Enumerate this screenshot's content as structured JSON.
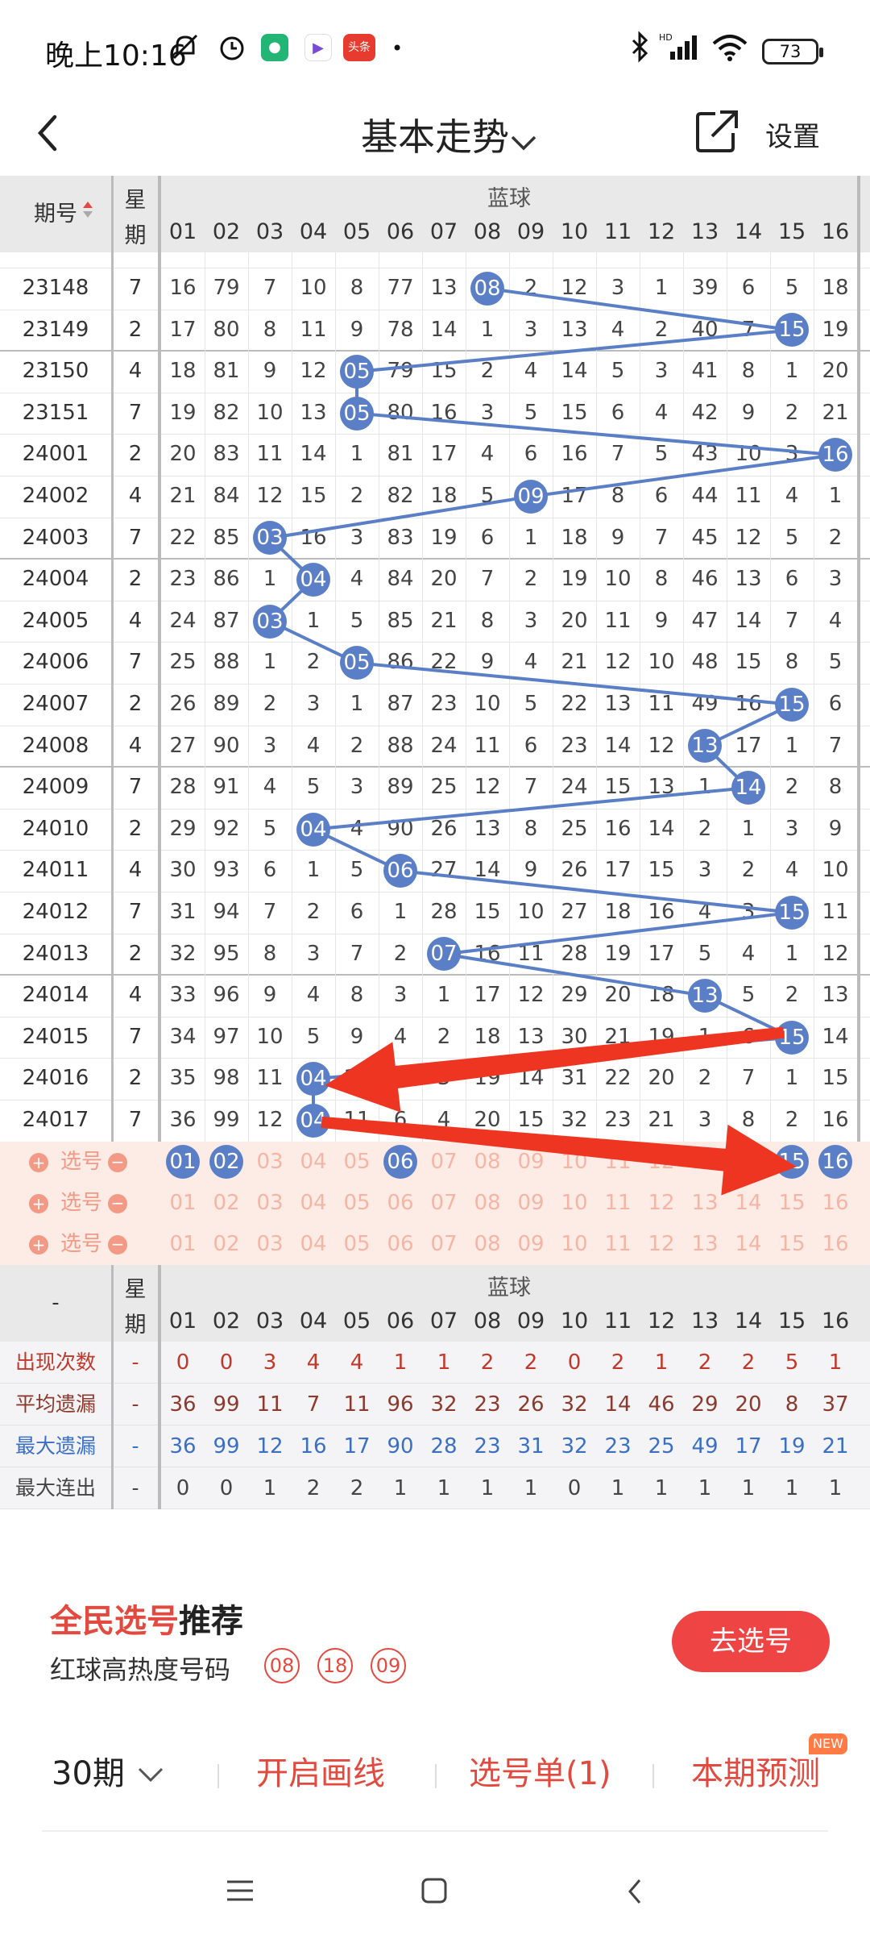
{
  "status_bar": {
    "time": "晚上10:16",
    "battery": "73",
    "app_icon_label": "头条"
  },
  "header": {
    "title": "基本走势",
    "settings_label": "设置"
  },
  "chart": {
    "section_label": "蓝球",
    "col_period_label": "期号",
    "col_week_label_top": "星",
    "col_week_label_bottom": "期",
    "columns": [
      "01",
      "02",
      "03",
      "04",
      "05",
      "06",
      "07",
      "08",
      "09",
      "10",
      "11",
      "12",
      "13",
      "14",
      "15",
      "16"
    ],
    "rows": [
      {
        "period": "23148",
        "week": "7",
        "cells": [
          "16",
          "79",
          "7",
          "10",
          "8",
          "77",
          "13",
          "08",
          "2",
          "12",
          "3",
          "1",
          "39",
          "6",
          "5",
          "18"
        ],
        "hit": 8
      },
      {
        "period": "23149",
        "week": "2",
        "cells": [
          "17",
          "80",
          "8",
          "11",
          "9",
          "78",
          "14",
          "1",
          "3",
          "13",
          "4",
          "2",
          "40",
          "7",
          "15",
          "19"
        ],
        "hit": 15
      },
      {
        "period": "23150",
        "week": "4",
        "cells": [
          "18",
          "81",
          "9",
          "12",
          "05",
          "79",
          "15",
          "2",
          "4",
          "14",
          "5",
          "3",
          "41",
          "8",
          "1",
          "20"
        ],
        "hit": 5
      },
      {
        "period": "23151",
        "week": "7",
        "cells": [
          "19",
          "82",
          "10",
          "13",
          "05",
          "80",
          "16",
          "3",
          "5",
          "15",
          "6",
          "4",
          "42",
          "9",
          "2",
          "21"
        ],
        "hit": 5
      },
      {
        "period": "24001",
        "week": "2",
        "cells": [
          "20",
          "83",
          "11",
          "14",
          "1",
          "81",
          "17",
          "4",
          "6",
          "16",
          "7",
          "5",
          "43",
          "10",
          "3",
          "16"
        ],
        "hit": 16
      },
      {
        "period": "24002",
        "week": "4",
        "cells": [
          "21",
          "84",
          "12",
          "15",
          "2",
          "82",
          "18",
          "5",
          "09",
          "17",
          "8",
          "6",
          "44",
          "11",
          "4",
          "1"
        ],
        "hit": 9
      },
      {
        "period": "24003",
        "week": "7",
        "cells": [
          "22",
          "85",
          "03",
          "16",
          "3",
          "83",
          "19",
          "6",
          "1",
          "18",
          "9",
          "7",
          "45",
          "12",
          "5",
          "2"
        ],
        "hit": 3
      },
      {
        "period": "24004",
        "week": "2",
        "cells": [
          "23",
          "86",
          "1",
          "04",
          "4",
          "84",
          "20",
          "7",
          "2",
          "19",
          "10",
          "8",
          "46",
          "13",
          "6",
          "3"
        ],
        "hit": 4
      },
      {
        "period": "24005",
        "week": "4",
        "cells": [
          "24",
          "87",
          "03",
          "1",
          "5",
          "85",
          "21",
          "8",
          "3",
          "20",
          "11",
          "9",
          "47",
          "14",
          "7",
          "4"
        ],
        "hit": 3
      },
      {
        "period": "24006",
        "week": "7",
        "cells": [
          "25",
          "88",
          "1",
          "2",
          "05",
          "86",
          "22",
          "9",
          "4",
          "21",
          "12",
          "10",
          "48",
          "15",
          "8",
          "5"
        ],
        "hit": 5
      },
      {
        "period": "24007",
        "week": "2",
        "cells": [
          "26",
          "89",
          "2",
          "3",
          "1",
          "87",
          "23",
          "10",
          "5",
          "22",
          "13",
          "11",
          "49",
          "16",
          "15",
          "6"
        ],
        "hit": 15
      },
      {
        "period": "24008",
        "week": "4",
        "cells": [
          "27",
          "90",
          "3",
          "4",
          "2",
          "88",
          "24",
          "11",
          "6",
          "23",
          "14",
          "12",
          "13",
          "17",
          "1",
          "7"
        ],
        "hit": 13
      },
      {
        "period": "24009",
        "week": "7",
        "cells": [
          "28",
          "91",
          "4",
          "5",
          "3",
          "89",
          "25",
          "12",
          "7",
          "24",
          "15",
          "13",
          "1",
          "14",
          "2",
          "8"
        ],
        "hit": 14
      },
      {
        "period": "24010",
        "week": "2",
        "cells": [
          "29",
          "92",
          "5",
          "04",
          "4",
          "90",
          "26",
          "13",
          "8",
          "25",
          "16",
          "14",
          "2",
          "1",
          "3",
          "9"
        ],
        "hit": 4
      },
      {
        "period": "24011",
        "week": "4",
        "cells": [
          "30",
          "93",
          "6",
          "1",
          "5",
          "06",
          "27",
          "14",
          "9",
          "26",
          "17",
          "15",
          "3",
          "2",
          "4",
          "10"
        ],
        "hit": 6
      },
      {
        "period": "24012",
        "week": "7",
        "cells": [
          "31",
          "94",
          "7",
          "2",
          "6",
          "1",
          "28",
          "15",
          "10",
          "27",
          "18",
          "16",
          "4",
          "3",
          "15",
          "11"
        ],
        "hit": 15
      },
      {
        "period": "24013",
        "week": "2",
        "cells": [
          "32",
          "95",
          "8",
          "3",
          "7",
          "2",
          "07",
          "16",
          "11",
          "28",
          "19",
          "17",
          "5",
          "4",
          "1",
          "12"
        ],
        "hit": 7
      },
      {
        "period": "24014",
        "week": "4",
        "cells": [
          "33",
          "96",
          "9",
          "4",
          "8",
          "3",
          "1",
          "17",
          "12",
          "29",
          "20",
          "18",
          "13",
          "5",
          "2",
          "13"
        ],
        "hit": 13
      },
      {
        "period": "24015",
        "week": "7",
        "cells": [
          "34",
          "97",
          "10",
          "5",
          "9",
          "4",
          "2",
          "18",
          "13",
          "30",
          "21",
          "19",
          "1",
          "6",
          "15",
          "14"
        ],
        "hit": 15
      },
      {
        "period": "24016",
        "week": "2",
        "cells": [
          "35",
          "98",
          "11",
          "04",
          "10",
          "5",
          "3",
          "19",
          "14",
          "31",
          "22",
          "20",
          "2",
          "7",
          "1",
          "15"
        ],
        "hit": 4
      },
      {
        "period": "24017",
        "week": "7",
        "cells": [
          "36",
          "99",
          "12",
          "04",
          "11",
          "6",
          "4",
          "20",
          "15",
          "32",
          "23",
          "21",
          "3",
          "8",
          "2",
          "16"
        ],
        "hit": 4
      }
    ],
    "pick_label": "选号",
    "pick_rows": [
      {
        "selected": [
          1,
          2,
          6,
          15,
          16
        ]
      },
      {
        "selected": []
      },
      {
        "selected": []
      }
    ],
    "stats": [
      {
        "label": "出现次数",
        "dash": "-",
        "values": [
          "0",
          "0",
          "3",
          "4",
          "4",
          "1",
          "1",
          "2",
          "2",
          "0",
          "2",
          "1",
          "2",
          "2",
          "5",
          "1"
        ],
        "color": "#c0392b"
      },
      {
        "label": "平均遗漏",
        "dash": "-",
        "values": [
          "36",
          "99",
          "11",
          "7",
          "11",
          "96",
          "32",
          "23",
          "26",
          "32",
          "14",
          "46",
          "29",
          "20",
          "8",
          "37"
        ],
        "color": "#8b3a2e"
      },
      {
        "label": "最大遗漏",
        "dash": "-",
        "values": [
          "36",
          "99",
          "12",
          "16",
          "17",
          "90",
          "28",
          "23",
          "31",
          "32",
          "23",
          "25",
          "49",
          "17",
          "19",
          "21"
        ],
        "color": "#3b6fc4"
      },
      {
        "label": "最大连出",
        "dash": "-",
        "values": [
          "0",
          "0",
          "1",
          "2",
          "2",
          "1",
          "1",
          "1",
          "1",
          "0",
          "1",
          "1",
          "1",
          "1",
          "1",
          "1"
        ],
        "color": "#444"
      }
    ],
    "stats_dash_label": "-",
    "colors": {
      "ball": "#5b7fc7",
      "line": "#5b7fc7",
      "arrow": "#ee3522",
      "pick_bg": "#fdece6",
      "header_bg": "#e9e9e9"
    }
  },
  "recommend": {
    "title_highlight": "全民选号",
    "title_rest": "推荐",
    "subtitle": "红球高热度号码",
    "hot_numbers": [
      "08",
      "18",
      "09"
    ],
    "button": "去选号"
  },
  "bottom_bar": {
    "period_select": "30期",
    "draw_lines": "开启画线",
    "pick_list": "选号单(1)",
    "prediction": "本期预测",
    "new_tag": "NEW"
  }
}
